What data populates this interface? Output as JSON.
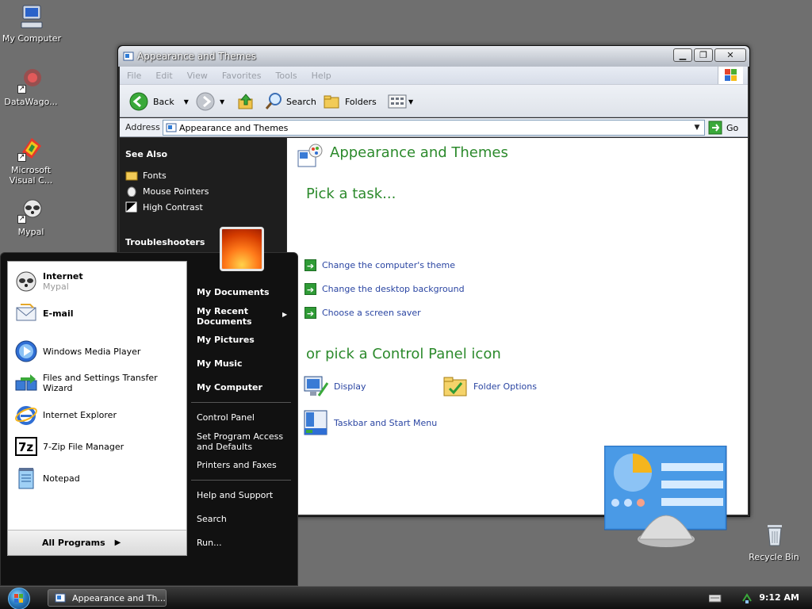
{
  "desktop": {
    "icons": [
      {
        "label": "My Computer"
      },
      {
        "label": "DataWago..."
      },
      {
        "label": "Microsoft Visual C..."
      },
      {
        "label": "Mypal"
      },
      {
        "label": "Recycle Bin"
      }
    ]
  },
  "window": {
    "title": "Appearance and Themes",
    "menu": [
      "File",
      "Edit",
      "View",
      "Favorites",
      "Tools",
      "Help"
    ],
    "toolbar": {
      "back": "Back",
      "search": "Search",
      "folders": "Folders"
    },
    "address": {
      "label": "Address",
      "value": "Appearance and Themes",
      "go": "Go"
    },
    "taskpane": {
      "see_also": "See Also",
      "links": [
        "Fonts",
        "Mouse Pointers",
        "High Contrast"
      ],
      "troubleshooters": "Troubleshooters"
    },
    "content": {
      "title": "Appearance and Themes",
      "pick_task": "Pick a task...",
      "tasks": [
        "Change the computer's theme",
        "Change the desktop background",
        "Choose a screen saver"
      ],
      "pick_icon": "or pick a Control Panel icon",
      "icons": [
        "Display",
        "Folder Options",
        "Taskbar and Start Menu"
      ]
    }
  },
  "startmenu": {
    "pinned": [
      {
        "title": "Internet",
        "sub": "Mypal"
      },
      {
        "title": "E-mail",
        "sub": ""
      }
    ],
    "recent": [
      "Windows Media Player",
      "Files and Settings Transfer Wizard",
      "Internet Explorer",
      "7-Zip File Manager",
      "Notepad"
    ],
    "all_programs": "All Programs",
    "right": [
      "My Documents",
      "My Recent Documents",
      "My Pictures",
      "My Music",
      "My Computer",
      "Control Panel",
      "Set Program Access and Defaults",
      "Printers and Faxes",
      "Help and Support",
      "Search",
      "Run..."
    ]
  },
  "taskbar": {
    "task_label": "Appearance and Th...",
    "clock": "9:12 AM"
  },
  "colors": {
    "accent_green": "#2c8a2c",
    "link_blue": "#2a45a2"
  }
}
